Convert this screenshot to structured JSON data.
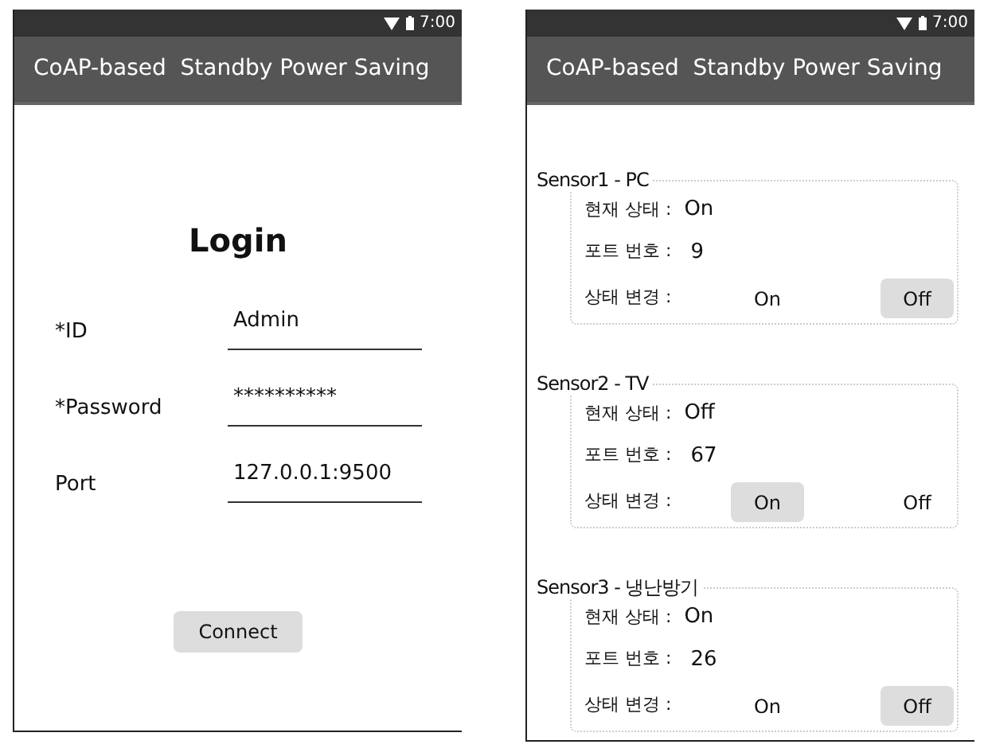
{
  "screens": [
    {
      "kind": "login",
      "status_bar": {
        "time": "7:00"
      },
      "app_bar": {
        "title": "CoAP-based  Standby Power Saving"
      },
      "heading": "Login",
      "fields": [
        {
          "label": "*ID",
          "value": "Admin"
        },
        {
          "label": "*Password",
          "value": "**********"
        },
        {
          "label": "Port",
          "value": "127.0.0.1:9500"
        }
      ],
      "button": "Connect"
    },
    {
      "kind": "sensors",
      "status_bar": {
        "time": "7:00"
      },
      "app_bar": {
        "title": "CoAP-based  Standby Power Saving"
      },
      "sensors": [
        {
          "title": "Sensor1 - PC",
          "state_label": "현재 상태 :",
          "state": "On",
          "port_label": "포트 번호 :",
          "port": "9",
          "change_label": "상태 변경 :",
          "buttons": [
            {
              "label": "On",
              "enabled": false
            },
            {
              "label": "Off",
              "enabled": true
            }
          ]
        },
        {
          "title": "Sensor2 - TV",
          "state_label": "현재 상태 :",
          "state": "Off",
          "port_label": "포트 번호 :",
          "port": "67",
          "change_label": "상태 변경 :",
          "buttons": [
            {
              "label": "On",
              "enabled": true
            },
            {
              "label": "Off",
              "enabled": false
            }
          ]
        },
        {
          "title": "Sensor3 - 냉난방기",
          "state_label": "현재 상태 :",
          "state": "On",
          "port_label": "포트 번호 :",
          "port": "26",
          "change_label": "상태 변경 :",
          "buttons": [
            {
              "label": "On",
              "enabled": false
            },
            {
              "label": "Off",
              "enabled": true
            }
          ]
        }
      ]
    }
  ]
}
